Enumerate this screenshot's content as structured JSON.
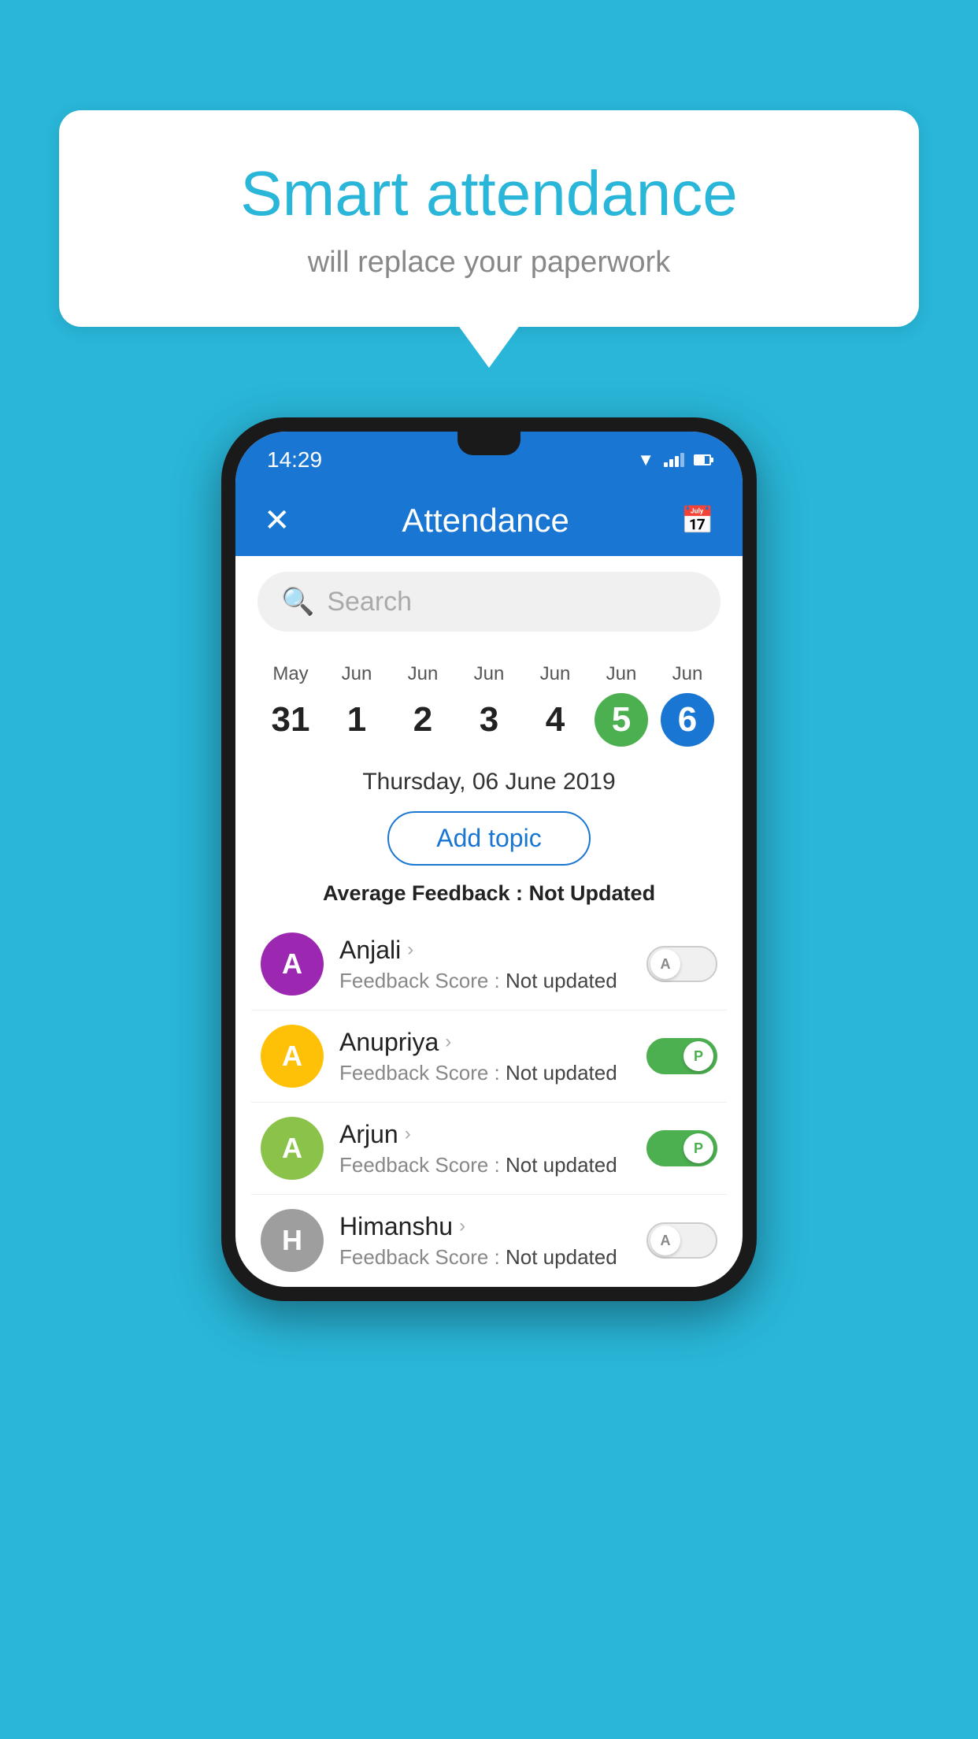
{
  "background_color": "#29b6d8",
  "bubble": {
    "title": "Smart attendance",
    "subtitle": "will replace your paperwork"
  },
  "status_bar": {
    "time": "14:29",
    "wifi_icon": "wifi",
    "signal_icon": "signal",
    "battery_icon": "battery"
  },
  "app_bar": {
    "title": "Attendance",
    "close_icon": "✕",
    "calendar_icon": "📅"
  },
  "search": {
    "placeholder": "Search"
  },
  "calendar": {
    "days": [
      {
        "month": "May",
        "date": "31",
        "style": "normal"
      },
      {
        "month": "Jun",
        "date": "1",
        "style": "normal"
      },
      {
        "month": "Jun",
        "date": "2",
        "style": "normal"
      },
      {
        "month": "Jun",
        "date": "3",
        "style": "normal"
      },
      {
        "month": "Jun",
        "date": "4",
        "style": "normal"
      },
      {
        "month": "Jun",
        "date": "5",
        "style": "today"
      },
      {
        "month": "Jun",
        "date": "6",
        "style": "selected"
      }
    ]
  },
  "selected_date": "Thursday, 06 June 2019",
  "add_topic_label": "Add topic",
  "avg_feedback_label": "Average Feedback :",
  "avg_feedback_value": "Not Updated",
  "students": [
    {
      "name": "Anjali",
      "avatar_letter": "A",
      "avatar_color": "#9c27b0",
      "feedback_label": "Feedback Score :",
      "feedback_value": "Not updated",
      "toggle": "off",
      "toggle_letter": "A"
    },
    {
      "name": "Anupriya",
      "avatar_letter": "A",
      "avatar_color": "#ffc107",
      "feedback_label": "Feedback Score :",
      "feedback_value": "Not updated",
      "toggle": "on",
      "toggle_letter": "P"
    },
    {
      "name": "Arjun",
      "avatar_letter": "A",
      "avatar_color": "#8bc34a",
      "feedback_label": "Feedback Score :",
      "feedback_value": "Not updated",
      "toggle": "on",
      "toggle_letter": "P"
    },
    {
      "name": "Himanshu",
      "avatar_letter": "H",
      "avatar_color": "#9e9e9e",
      "feedback_label": "Feedback Score :",
      "feedback_value": "Not updated",
      "toggle": "off",
      "toggle_letter": "A"
    }
  ]
}
